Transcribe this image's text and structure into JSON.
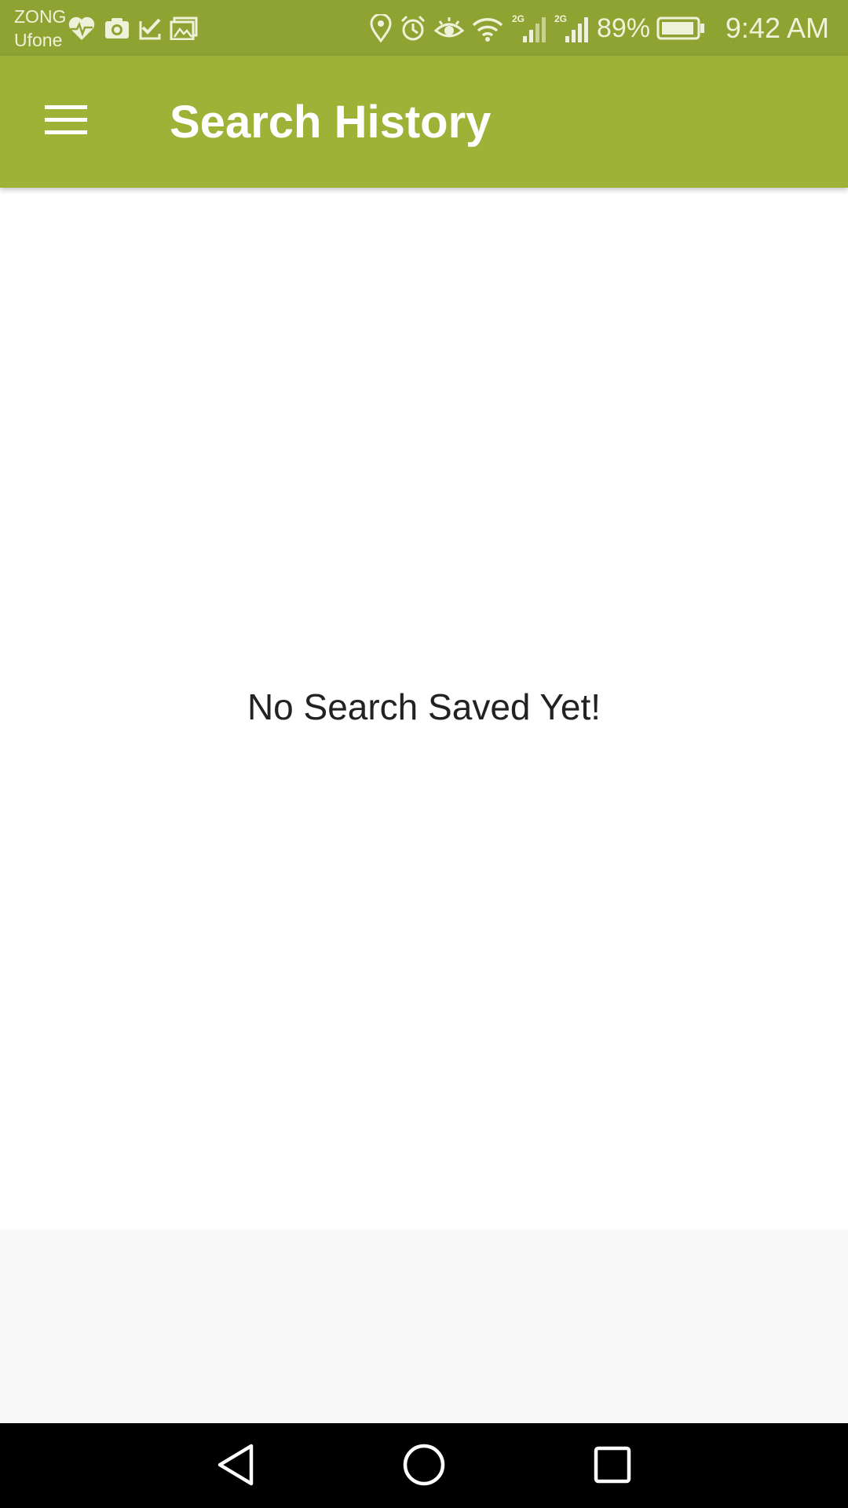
{
  "status_bar": {
    "carrier_1": "ZONG",
    "carrier_2": "Ufone",
    "notification_icons": [
      "heart-pulse-icon",
      "camera-icon",
      "checklist-icon",
      "gallery-icon"
    ],
    "system_icons": [
      "location-icon",
      "alarm-icon",
      "eye-comfort-icon",
      "wifi-icon",
      "signal-2g-icon",
      "signal-2g-icon"
    ],
    "network_label_1": "2G",
    "network_label_2": "2G",
    "battery_percent": "89%",
    "time": "9:42 AM"
  },
  "app_bar": {
    "title": "Search History",
    "menu_icon": "hamburger-menu-icon",
    "color": "#9db236"
  },
  "content": {
    "empty_message": "No Search Saved Yet!"
  },
  "nav_bar": {
    "icons": [
      "back-icon",
      "home-icon",
      "recents-icon"
    ]
  },
  "colors": {
    "status_bar": "#8fa333",
    "app_bar": "#9db236",
    "background": "#ffffff",
    "text": "#222222"
  }
}
